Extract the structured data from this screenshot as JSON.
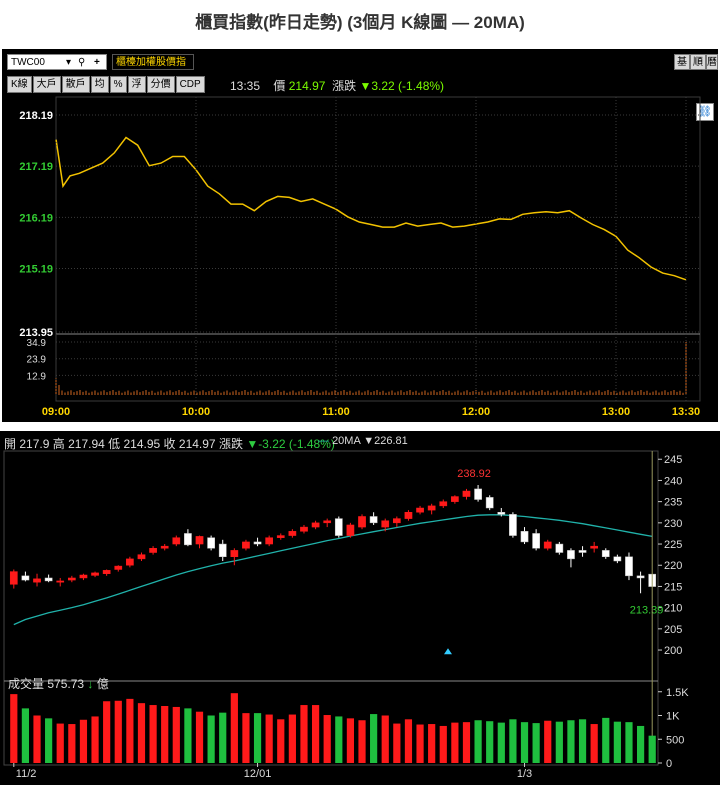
{
  "title": "櫃買指數(昨日走勢) (3個月 K線圖 — 20MA)",
  "intraday": {
    "symbol": "TWC00",
    "index_name": "櫃檯加權股價指",
    "right_buttons": [
      "基",
      "順",
      "曆"
    ],
    "tabs": [
      "K線",
      "大戶",
      "散戶",
      "均",
      "%",
      "浮",
      "分價",
      "CDP"
    ],
    "time": "13:35",
    "price_label": "價",
    "price": "214.97",
    "change_label": "漲跌",
    "change": "▼3.22 (-1.48%)",
    "colors": {
      "line": "#f2c200",
      "up_label": "#33cc33",
      "volume": "#d0661f",
      "grid": "#3a3a3a"
    }
  },
  "kline": {
    "open_label": "開",
    "open": "217.9",
    "high_label": "高",
    "high": "217.94",
    "low_label": "低",
    "low": "214.95",
    "close_label": "收",
    "close": "214.97",
    "change_label": "漲跌",
    "change": "▼-3.22 (-1.48%)",
    "ma_name": "20MA",
    "ma_value": "▼226.81",
    "vol_label": "成交量",
    "vol_value": "575.73",
    "vol_arrow": "↓",
    "vol_unit": "億",
    "colors": {
      "up": "#ff1a1a",
      "down": "#1fbf3f",
      "ma": "#20b2aa",
      "max_label": "#ff3333",
      "min_label": "#33cc33"
    }
  },
  "chart_data": [
    {
      "type": "line",
      "title": "",
      "x_ticks": [
        "09:00",
        "10:00",
        "11:00",
        "12:00",
        "13:00",
        "13:30"
      ],
      "y_ticks": [
        218.19,
        217.19,
        216.19,
        215.19,
        213.95
      ],
      "ylim": [
        213.95,
        218.19
      ],
      "x": [
        "09:00",
        "09:03",
        "09:06",
        "09:10",
        "09:15",
        "09:20",
        "09:25",
        "09:30",
        "09:35",
        "09:40",
        "09:45",
        "09:50",
        "09:55",
        "10:00",
        "10:05",
        "10:10",
        "10:15",
        "10:20",
        "10:25",
        "10:30",
        "10:35",
        "10:40",
        "10:45",
        "10:50",
        "10:55",
        "11:00",
        "11:05",
        "11:10",
        "11:15",
        "11:20",
        "11:25",
        "11:30",
        "11:35",
        "11:40",
        "11:45",
        "11:50",
        "11:55",
        "12:00",
        "12:05",
        "12:10",
        "12:15",
        "12:20",
        "12:25",
        "12:30",
        "12:35",
        "12:40",
        "12:45",
        "12:50",
        "12:55",
        "13:00",
        "13:05",
        "13:10",
        "13:15",
        "13:20",
        "13:25",
        "13:30"
      ],
      "values": [
        217.72,
        216.8,
        217.0,
        217.05,
        217.15,
        217.25,
        217.45,
        217.75,
        217.6,
        217.2,
        217.25,
        217.38,
        217.38,
        217.12,
        216.8,
        216.65,
        216.45,
        216.45,
        216.32,
        216.5,
        216.6,
        216.58,
        216.5,
        216.55,
        216.45,
        216.35,
        216.2,
        216.1,
        216.05,
        216.0,
        216.0,
        216.08,
        216.02,
        216.05,
        216.08,
        216.0,
        216.02,
        216.06,
        216.1,
        216.16,
        216.15,
        216.25,
        216.28,
        216.3,
        216.28,
        216.32,
        216.18,
        216.05,
        215.95,
        215.82,
        215.55,
        215.4,
        215.22,
        215.1,
        215.05,
        214.97
      ],
      "volume": {
        "y_ticks": [
          34.9,
          23.9,
          12.9
        ],
        "spike_at": "13:30",
        "spike_value": 34.9,
        "opening_value": 11.0,
        "typical_value": 2.5
      }
    },
    {
      "type": "candlestick",
      "title": "",
      "x_ticks": [
        "11/2",
        "12/01",
        "1/3"
      ],
      "y_ticks": [
        245,
        240,
        235,
        230,
        225,
        220,
        215,
        210,
        205,
        200
      ],
      "ylim": [
        196,
        246
      ],
      "max_label": "238.92",
      "min_label": "213.39",
      "candles": [
        [
          215.5,
          219.0,
          214.5,
          218.5
        ],
        [
          217.5,
          218.5,
          216.2,
          216.5
        ],
        [
          216.0,
          218.0,
          215.0,
          216.8
        ],
        [
          217.0,
          217.8,
          216.0,
          216.3
        ],
        [
          216.0,
          217.0,
          215.0,
          216.3
        ],
        [
          216.5,
          217.5,
          216.0,
          217.0
        ],
        [
          217.0,
          218.0,
          216.5,
          217.7
        ],
        [
          217.6,
          218.5,
          217.2,
          218.2
        ],
        [
          218.0,
          219.0,
          217.5,
          218.8
        ],
        [
          219.0,
          220.0,
          218.5,
          219.8
        ],
        [
          220.0,
          222.0,
          219.5,
          221.5
        ],
        [
          221.5,
          223.0,
          221.0,
          222.5
        ],
        [
          223.0,
          224.5,
          222.5,
          224.0
        ],
        [
          224.0,
          225.0,
          223.5,
          224.5
        ],
        [
          225.0,
          227.0,
          224.5,
          226.5
        ],
        [
          227.5,
          228.5,
          224.5,
          224.8
        ],
        [
          225.0,
          227.0,
          224.0,
          226.8
        ],
        [
          226.5,
          227.0,
          223.5,
          224.0
        ],
        [
          225.0,
          226.0,
          221.0,
          222.0
        ],
        [
          222.0,
          224.0,
          220.0,
          223.5
        ],
        [
          224.0,
          226.0,
          223.5,
          225.5
        ],
        [
          225.5,
          226.5,
          224.5,
          225.0
        ],
        [
          225.0,
          227.0,
          224.5,
          226.5
        ],
        [
          226.5,
          227.5,
          226.0,
          227.0
        ],
        [
          227.0,
          228.5,
          226.5,
          228.0
        ],
        [
          228.0,
          229.5,
          227.5,
          229.0
        ],
        [
          229.0,
          230.5,
          228.5,
          230.0
        ],
        [
          230.0,
          231.0,
          229.0,
          230.5
        ],
        [
          231.0,
          231.5,
          226.5,
          227.0
        ],
        [
          227.0,
          230.0,
          226.5,
          229.5
        ],
        [
          229.0,
          232.0,
          228.5,
          231.5
        ],
        [
          231.5,
          232.5,
          229.5,
          230.0
        ],
        [
          229.0,
          231.0,
          228.0,
          230.5
        ],
        [
          230.0,
          231.5,
          229.0,
          231.0
        ],
        [
          231.0,
          233.0,
          230.5,
          232.5
        ],
        [
          232.5,
          234.0,
          232.0,
          233.5
        ],
        [
          233.0,
          234.5,
          232.0,
          234.0
        ],
        [
          234.0,
          235.5,
          233.5,
          235.0
        ],
        [
          235.0,
          236.5,
          234.5,
          236.2
        ],
        [
          236.2,
          238.0,
          235.5,
          237.5
        ],
        [
          238.0,
          238.92,
          235.0,
          235.5
        ],
        [
          236.0,
          236.5,
          233.0,
          233.5
        ],
        [
          232.5,
          233.5,
          231.5,
          232.0
        ],
        [
          232.0,
          232.5,
          226.5,
          227.0
        ],
        [
          228.0,
          229.0,
          225.0,
          225.5
        ],
        [
          227.5,
          228.5,
          223.5,
          224.0
        ],
        [
          224.0,
          226.0,
          223.5,
          225.5
        ],
        [
          225.0,
          225.5,
          222.5,
          223.0
        ],
        [
          223.5,
          224.0,
          219.5,
          221.5
        ],
        [
          223.5,
          224.5,
          222.0,
          223.0
        ],
        [
          224.0,
          225.5,
          223.0,
          224.5
        ],
        [
          223.5,
          224.0,
          221.5,
          222.0
        ],
        [
          222.0,
          222.5,
          220.5,
          221.0
        ],
        [
          222.0,
          223.0,
          216.5,
          217.5
        ],
        [
          217.5,
          218.5,
          213.39,
          217.0
        ],
        [
          217.9,
          217.94,
          214.95,
          214.97
        ]
      ],
      "ma20": [
        206.0,
        207.2,
        208.0,
        208.8,
        209.4,
        210.0,
        210.7,
        211.5,
        212.3,
        213.2,
        214.1,
        215.0,
        215.9,
        216.8,
        217.7,
        218.5,
        219.2,
        219.9,
        220.5,
        221.0,
        221.6,
        222.2,
        222.8,
        223.4,
        224.0,
        224.6,
        225.2,
        225.8,
        226.3,
        226.9,
        227.4,
        227.9,
        228.4,
        228.9,
        229.4,
        229.9,
        230.3,
        230.7,
        231.1,
        231.5,
        231.8,
        231.9,
        231.9,
        231.7,
        231.5,
        231.2,
        230.9,
        230.6,
        230.2,
        229.8,
        229.3,
        228.8,
        228.3,
        227.8,
        227.3,
        226.81
      ],
      "volume_ticks": [
        "1.5K",
        "1K",
        "500",
        "0"
      ],
      "volume": [
        1450,
        1150,
        1000,
        940,
        830,
        820,
        910,
        980,
        1300,
        1310,
        1350,
        1260,
        1220,
        1200,
        1180,
        1150,
        1080,
        1000,
        1060,
        1470,
        1050,
        1050,
        1020,
        920,
        1020,
        1220,
        1220,
        1010,
        980,
        940,
        900,
        1030,
        1000,
        830,
        920,
        810,
        820,
        780,
        850,
        860,
        900,
        880,
        850,
        920,
        860,
        840,
        890,
        870,
        900,
        920,
        820,
        950,
        870,
        860,
        780,
        575
      ]
    }
  ]
}
